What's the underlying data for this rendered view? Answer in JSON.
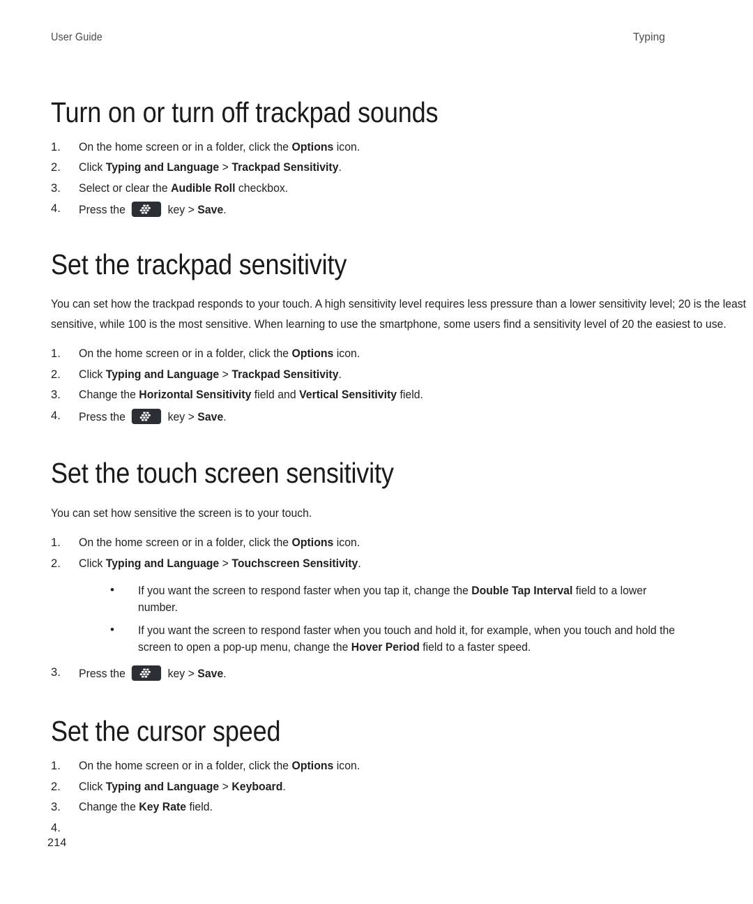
{
  "header": {
    "left": "User Guide",
    "right": "Typing"
  },
  "page_number": "214",
  "icons": {
    "blackberry_menu_key": "blackberry-menu-key-icon"
  },
  "sections": [
    {
      "heading": "Turn on or turn off trackpad sounds",
      "steps": [
        {
          "html": "On the home screen or in a folder, click the <b>Options</b> icon."
        },
        {
          "html": "Click <b>Typing and Language</b> <span class=\"gt\">&gt;</span> <b>Trackpad Sensitivity</b>."
        },
        {
          "html": "Select or clear the <b>Audible Roll</b> checkbox."
        },
        {
          "html": "Press the __BBKEY__ key <span class=\"gt\">&gt;</span> <b>Save</b>."
        }
      ]
    },
    {
      "heading": "Set the trackpad sensitivity",
      "paragraph": "You can set how the trackpad responds to your touch. A high sensitivity level requires less pressure than a lower sensitivity level; 20 is the least sensitive, while 100 is the most sensitive. When learning to use the smartphone, some users find a sensitivity level of 20 the easiest to use.",
      "steps": [
        {
          "html": "On the home screen or in a folder, click the <b>Options</b> icon."
        },
        {
          "html": "Click <b>Typing and Language</b> <span class=\"gt\">&gt;</span> <b>Trackpad Sensitivity</b>."
        },
        {
          "html": "Change the <b>Horizontal Sensitivity</b> field and <b>Vertical Sensitivity</b> field."
        },
        {
          "html": "Press the __BBKEY__ key <span class=\"gt\">&gt;</span> <b>Save</b>."
        }
      ]
    },
    {
      "heading": "Set the touch screen sensitivity",
      "paragraph": "You can set how sensitive the screen is to your touch.",
      "steps": [
        {
          "html": "On the home screen or in a folder, click the <b>Options</b> icon."
        },
        {
          "html": "Click <b>Typing and Language</b> <span class=\"gt\">&gt;</span> <b>Touchscreen Sensitivity</b>.",
          "bullets": [
            "If you want the screen to respond faster when you tap it, change the <b>Double Tap Interval</b> field to a lower number.",
            "If you want the screen to respond faster when you touch and hold it, for example, when you touch and hold the screen to open a pop-up menu, change the <b>Hover Period</b> field to a faster speed."
          ]
        },
        {
          "html": "Press the __BBKEY__ key <span class=\"gt\">&gt;</span> <b>Save</b>."
        }
      ]
    },
    {
      "heading": "Set the cursor speed",
      "steps": [
        {
          "html": "On the home screen or in a folder, click the <b>Options</b> icon."
        },
        {
          "html": "Click <b>Typing and Language</b> <span class=\"gt\">&gt;</span> <b>Keyboard</b>."
        },
        {
          "html": "Change the <b>Key Rate</b> field."
        },
        {
          "html": ""
        }
      ]
    }
  ]
}
